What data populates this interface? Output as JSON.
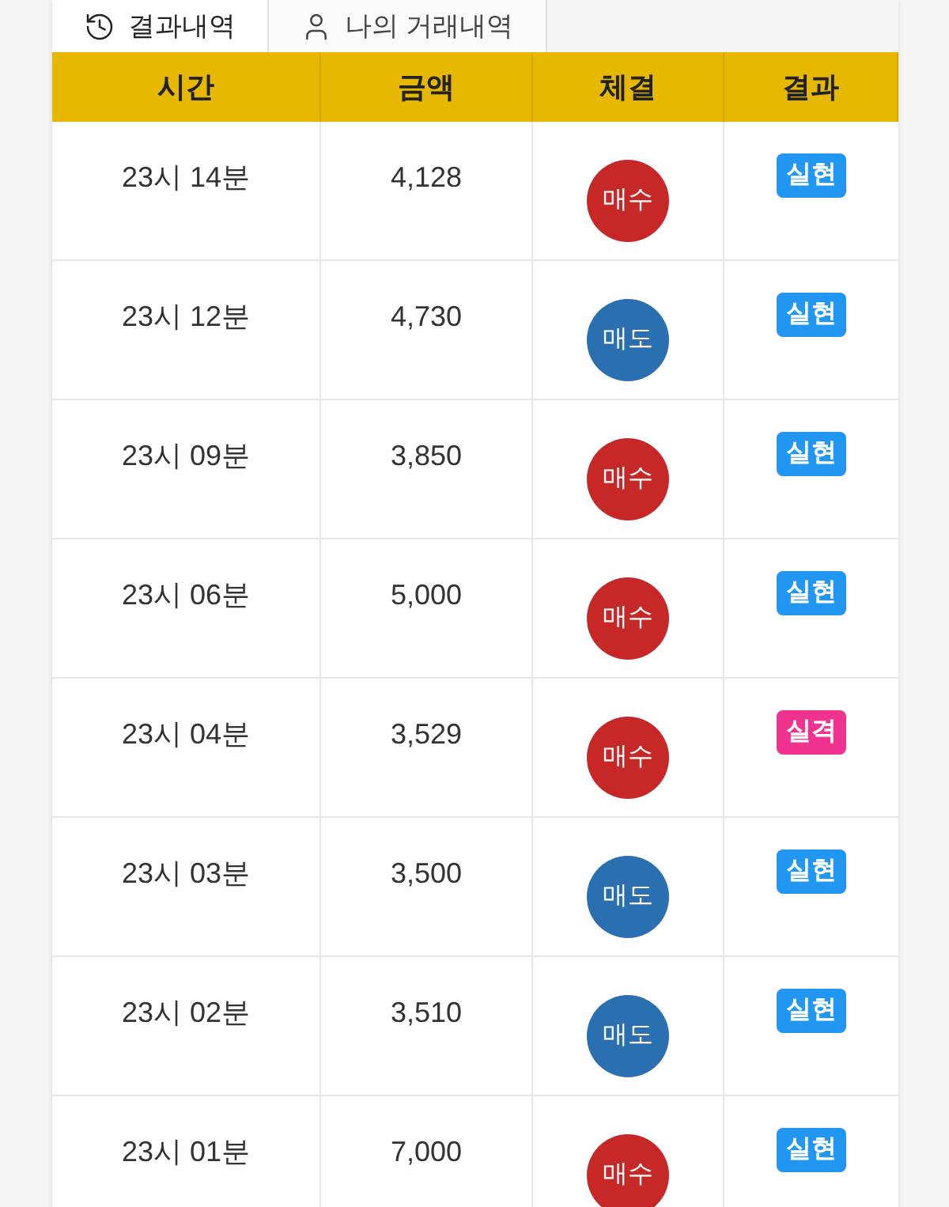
{
  "tabs": [
    {
      "label": "결과내역",
      "selected": true
    },
    {
      "label": "나의 거래내역",
      "selected": false
    }
  ],
  "table": {
    "columns": [
      "시간",
      "금액",
      "체결",
      "결과"
    ],
    "rows": [
      {
        "time": "23시 14분",
        "amount": "4,128",
        "side": {
          "kind": "buy",
          "label": "매수"
        },
        "result": {
          "kind": "hit",
          "label": "실현"
        }
      },
      {
        "time": "23시 12분",
        "amount": "4,730",
        "side": {
          "kind": "sell",
          "label": "매도"
        },
        "result": {
          "kind": "hit",
          "label": "실현"
        }
      },
      {
        "time": "23시 09분",
        "amount": "3,850",
        "side": {
          "kind": "buy",
          "label": "매수"
        },
        "result": {
          "kind": "hit",
          "label": "실현"
        }
      },
      {
        "time": "23시 06분",
        "amount": "5,000",
        "side": {
          "kind": "buy",
          "label": "매수"
        },
        "result": {
          "kind": "hit",
          "label": "실현"
        }
      },
      {
        "time": "23시 04분",
        "amount": "3,529",
        "side": {
          "kind": "buy",
          "label": "매수"
        },
        "result": {
          "kind": "miss",
          "label": "실격"
        }
      },
      {
        "time": "23시 03분",
        "amount": "3,500",
        "side": {
          "kind": "sell",
          "label": "매도"
        },
        "result": {
          "kind": "hit",
          "label": "실현"
        }
      },
      {
        "time": "23시 02분",
        "amount": "3,510",
        "side": {
          "kind": "sell",
          "label": "매도"
        },
        "result": {
          "kind": "hit",
          "label": "실현"
        }
      },
      {
        "time": "23시 01분",
        "amount": "7,000",
        "side": {
          "kind": "buy",
          "label": "매수"
        },
        "result": {
          "kind": "hit",
          "label": "실현"
        }
      }
    ]
  }
}
